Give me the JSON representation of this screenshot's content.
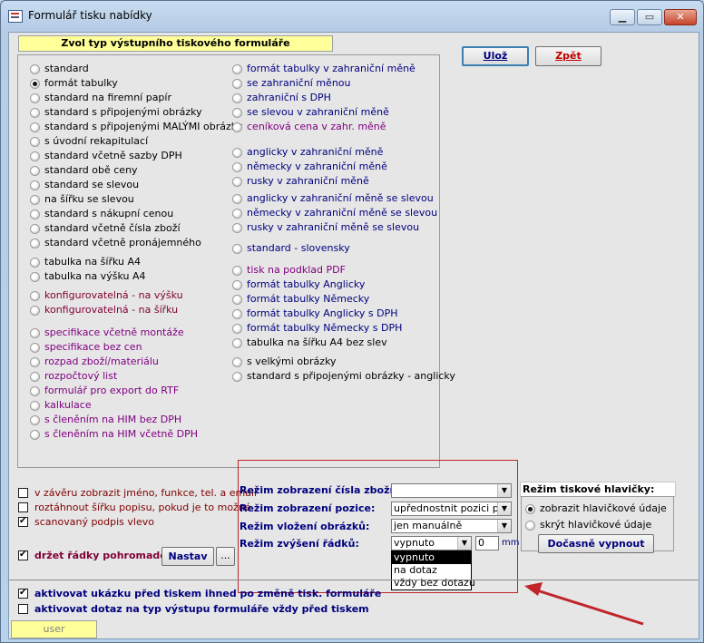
{
  "window": {
    "title": "Formulář tisku nabídky",
    "minimize": "▁",
    "maximize": "▭",
    "close": "✕"
  },
  "header_label": "Zvol typ výstupního tiskového formuláře",
  "buttons": {
    "save": "Ulož",
    "back": "Zpět",
    "nastav": "Nastav",
    "ellipsis": "...",
    "docasne": "Dočasně vypnout"
  },
  "options_left": [
    {
      "label": "standard",
      "selected": false,
      "color": "#000000"
    },
    {
      "label": "formát tabulky",
      "selected": true,
      "color": "#000000"
    },
    {
      "label": "standard na firemní papír",
      "selected": false,
      "color": "#000000"
    },
    {
      "label": "standard s připojenými obrázky",
      "selected": false,
      "color": "#000000"
    },
    {
      "label": "standard s připojenými MALÝMI obrázky",
      "selected": false,
      "color": "#000000"
    },
    {
      "label": "s úvodní rekapitulací",
      "selected": false,
      "color": "#000000"
    },
    {
      "label": "standard včetně sazby DPH",
      "selected": false,
      "color": "#000000"
    },
    {
      "label": "standard obě ceny",
      "selected": false,
      "color": "#000000"
    },
    {
      "label": "standard se slevou",
      "selected": false,
      "color": "#000000"
    },
    {
      "label": "na šířku se slevou",
      "selected": false,
      "color": "#000000"
    },
    {
      "label": "standard s nákupní cenou",
      "selected": false,
      "color": "#000000"
    },
    {
      "label": "standard včetně čísla zboží",
      "selected": false,
      "color": "#000000"
    },
    {
      "label": "standard včetně pronájemného",
      "selected": false,
      "color": "#000000"
    },
    {
      "label": "tabulka na šířku A4",
      "selected": false,
      "color": "#000000"
    },
    {
      "label": "tabulka na výšku A4",
      "selected": false,
      "color": "#000000"
    },
    {
      "label": "konfigurovatelná - na výšku",
      "selected": false,
      "color": "#7f0033"
    },
    {
      "label": "konfigurovatelná - na šířku",
      "selected": false,
      "color": "#7f0033"
    },
    {
      "label": "specifikace včetně montáže",
      "selected": false,
      "color": "#800080"
    },
    {
      "label": "specifikace bez cen",
      "selected": false,
      "color": "#800080"
    },
    {
      "label": "rozpad zboží/materiálu",
      "selected": false,
      "color": "#800080"
    },
    {
      "label": "rozpočtový list",
      "selected": false,
      "color": "#800080"
    },
    {
      "label": "formulář pro export do RTF",
      "selected": false,
      "color": "#800080"
    },
    {
      "label": "kalkulace",
      "selected": false,
      "color": "#800080"
    },
    {
      "label": "s členěním na HIM bez DPH",
      "selected": false,
      "color": "#800080"
    },
    {
      "label": "s členěním na HIM včetně DPH",
      "selected": false,
      "color": "#800080"
    }
  ],
  "options_right": [
    {
      "label": "formát tabulky v zahraniční měně",
      "selected": false,
      "color": "#00007f"
    },
    {
      "label": "se zahraniční měnou",
      "selected": false,
      "color": "#00007f"
    },
    {
      "label": "zahraniční s DPH",
      "selected": false,
      "color": "#00007f"
    },
    {
      "label": "se slevou v zahraniční měně",
      "selected": false,
      "color": "#00007f"
    },
    {
      "label": "ceníková cena v zahr. měně",
      "selected": false,
      "color": "#800080"
    },
    {
      "label": "anglicky v zahraniční měně",
      "selected": false,
      "color": "#00007f"
    },
    {
      "label": "německy v zahraniční měně",
      "selected": false,
      "color": "#00007f"
    },
    {
      "label": "rusky v zahraniční měně",
      "selected": false,
      "color": "#00007f"
    },
    {
      "label": "anglicky v zahraniční měně se slevou",
      "selected": false,
      "color": "#00007f"
    },
    {
      "label": "německy v zahraniční měně se slevou",
      "selected": false,
      "color": "#00007f"
    },
    {
      "label": "rusky v zahraniční měně se slevou",
      "selected": false,
      "color": "#00007f"
    },
    {
      "label": "standard - slovensky",
      "selected": false,
      "color": "#00007f"
    },
    {
      "label": "tisk na podklad PDF",
      "selected": false,
      "color": "#800080"
    },
    {
      "label": "formát tabulky Anglicky",
      "selected": false,
      "color": "#00007f"
    },
    {
      "label": "formát tabulky Německy",
      "selected": false,
      "color": "#00007f"
    },
    {
      "label": "formát tabulky Anglicky s DPH",
      "selected": false,
      "color": "#00007f"
    },
    {
      "label": "formát tabulky Německy s DPH",
      "selected": false,
      "color": "#00007f"
    },
    {
      "label": "tabulka na šířku A4 bez slev",
      "selected": false,
      "color": "#000000"
    },
    {
      "label": "s velkými obrázky",
      "selected": false,
      "color": "#000000"
    },
    {
      "label": "standard s připojenými obrázky - anglicky",
      "selected": false,
      "color": "#000000"
    }
  ],
  "checkboxes_left": [
    {
      "label": "v závěru zobrazit jméno, funkce, tel. a email",
      "checked": false
    },
    {
      "label": "roztáhnout šířku popisu, pokud je to možné",
      "checked": false
    },
    {
      "label": "scanovaný podpis vlevo",
      "checked": true
    }
  ],
  "drzet": {
    "label": "držet řádky pohromadě",
    "checked": true
  },
  "rezim": {
    "cislo_label": "Režim zobrazení čísla zboží:",
    "cislo_value": "",
    "pozice_label": "Režim zobrazení pozice:",
    "pozice_value": "upřednostnit pozici proje",
    "obrazku_label": "Režim vložení obrázků:",
    "obrazku_value": "jen manuálně",
    "radku_label": "Režim zvýšení řádků:",
    "radku_value": "vypnuto",
    "mm_value": "0",
    "mm_unit": "mm",
    "radku_options": [
      "vypnuto",
      "na dotaz",
      "vždy bez dotazu"
    ]
  },
  "hlavicka": {
    "title": "Režim tiskové hlavičky:",
    "opt1": "zobrazit hlavičkové údaje",
    "opt2": "skrýt hlavičkové údaje"
  },
  "bottom": {
    "ukazka": "aktivovat ukázku před tiskem ihned po změně tisk. formuláře",
    "dotaz": "aktivovat dotaz na typ výstupu formuláře vždy před tiskem",
    "user": "user"
  }
}
